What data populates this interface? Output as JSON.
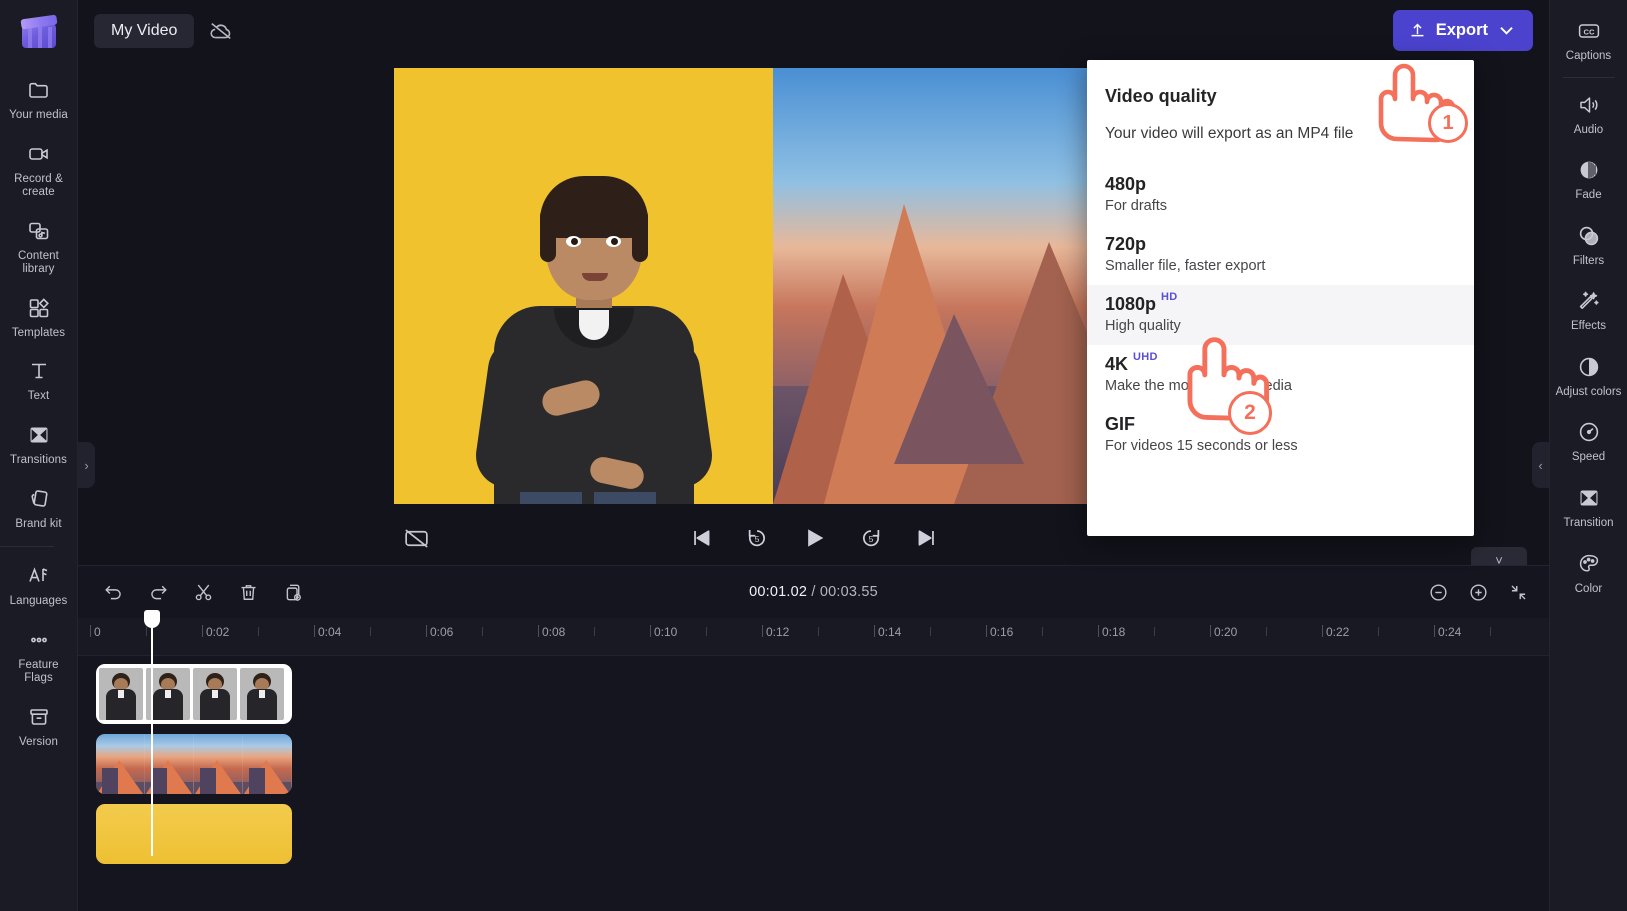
{
  "app": {
    "project_name": "My Video",
    "logo_name": "clipchamp-logo"
  },
  "topbar": {
    "cloud_status_icon": "cloud-off-icon",
    "export_label": "Export",
    "export_icon": "upload-icon",
    "export_caret_icon": "chevron-down-icon",
    "export_accent_color": "#4b43ce"
  },
  "left_sidebar": {
    "items": [
      {
        "label": "Your media",
        "icon": "folder-icon"
      },
      {
        "label": "Record & create",
        "icon": "video-camera-icon"
      },
      {
        "label": "Content library",
        "icon": "media-library-icon"
      },
      {
        "label": "Templates",
        "icon": "templates-icon"
      },
      {
        "label": "Text",
        "icon": "text-icon"
      },
      {
        "label": "Transitions",
        "icon": "transitions-icon"
      },
      {
        "label": "Brand kit",
        "icon": "brand-kit-icon"
      }
    ],
    "bottom_items": [
      {
        "label": "Languages",
        "icon": "languages-icon"
      },
      {
        "label": "Feature Flags",
        "icon": "ellipsis-icon"
      },
      {
        "label": "Version",
        "icon": "archive-icon"
      }
    ]
  },
  "right_sidebar": {
    "items": [
      {
        "label": "Captions",
        "icon": "cc-icon"
      },
      {
        "label": "Audio",
        "icon": "speaker-icon"
      },
      {
        "label": "Fade",
        "icon": "fade-icon"
      },
      {
        "label": "Filters",
        "icon": "filters-icon"
      },
      {
        "label": "Effects",
        "icon": "effects-wand-icon"
      },
      {
        "label": "Adjust colors",
        "icon": "contrast-icon"
      },
      {
        "label": "Speed",
        "icon": "speedometer-icon"
      },
      {
        "label": "Transition",
        "icon": "transition-icon"
      },
      {
        "label": "Color",
        "icon": "palette-icon"
      }
    ]
  },
  "export_menu": {
    "title": "Video quality",
    "subtitle": "Your video will export as an MP4 file",
    "options": [
      {
        "name": "480p",
        "badge": "",
        "description": "For drafts"
      },
      {
        "name": "720p",
        "badge": "",
        "description": "Smaller file, faster export"
      },
      {
        "name": "1080p",
        "badge": "HD",
        "description": "High quality"
      },
      {
        "name": "4K",
        "badge": "UHD",
        "description": "Make the most of your media"
      },
      {
        "name": "GIF",
        "badge": "",
        "description": "For videos 15 seconds or less"
      }
    ],
    "highlighted_option": "1080p",
    "badge_color": "#5a4ed6"
  },
  "annotations": {
    "step_one": "1",
    "step_two": "2",
    "accent_color": "#f4705a"
  },
  "preview": {
    "captions_toggle_icon": "cc-off-icon",
    "transport": [
      {
        "icon": "skip-back-icon",
        "label": ""
      },
      {
        "icon": "rewind-5-icon",
        "label": "5"
      },
      {
        "icon": "play-icon",
        "label": ""
      },
      {
        "icon": "forward-5-icon",
        "label": "5"
      },
      {
        "icon": "skip-forward-icon",
        "label": ""
      }
    ],
    "collapse_left_icon": "chevron-right-icon",
    "collapse_right_icon": "chevron-left-icon",
    "panel_caret_icon": "chevron-down-icon"
  },
  "timeline": {
    "tools": [
      {
        "icon": "undo-icon",
        "name": "undo"
      },
      {
        "icon": "redo-icon",
        "name": "redo"
      },
      {
        "icon": "scissors-icon",
        "name": "split"
      },
      {
        "icon": "trash-icon",
        "name": "delete"
      },
      {
        "icon": "duplicate-icon",
        "name": "duplicate"
      }
    ],
    "current_time": "00:01.02",
    "separator": "/",
    "total_time": "00:03.55",
    "zoom_controls": [
      {
        "icon": "zoom-out-icon",
        "name": "zoom-out"
      },
      {
        "icon": "zoom-in-icon",
        "name": "zoom-in"
      },
      {
        "icon": "fit-icon",
        "name": "fit-to-screen"
      }
    ],
    "ruler_labels": [
      "0",
      "0:02",
      "0:04",
      "0:06",
      "0:08",
      "0:10",
      "0:12",
      "0:14",
      "0:16",
      "0:18",
      "0:20",
      "0:22",
      "0:24"
    ],
    "playhead_time": "00:01.02",
    "tracks": [
      {
        "name": "video-track-person",
        "clip_label": ""
      },
      {
        "name": "video-track-mountain",
        "clip_label": ""
      },
      {
        "name": "background-track",
        "clip_label": ""
      }
    ]
  }
}
